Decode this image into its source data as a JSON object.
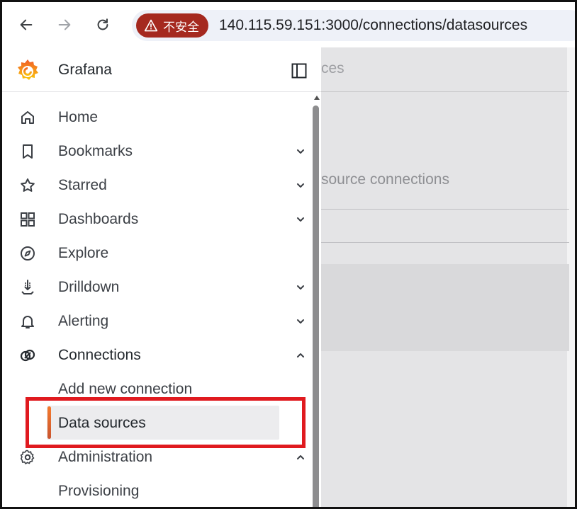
{
  "browser": {
    "security_label": "不安全",
    "url": "140.115.59.151:3000/connections/datasources"
  },
  "sidebar": {
    "brand": "Grafana",
    "items": [
      {
        "label": "Home",
        "icon": "home-icon",
        "expandable": false
      },
      {
        "label": "Bookmarks",
        "icon": "bookmark-icon",
        "expandable": true,
        "expanded": false
      },
      {
        "label": "Starred",
        "icon": "star-icon",
        "expandable": true,
        "expanded": false
      },
      {
        "label": "Dashboards",
        "icon": "apps-icon",
        "expandable": true,
        "expanded": false
      },
      {
        "label": "Explore",
        "icon": "compass-icon",
        "expandable": false
      },
      {
        "label": "Drilldown",
        "icon": "drilldown-icon",
        "expandable": true,
        "expanded": false
      },
      {
        "label": "Alerting",
        "icon": "bell-icon",
        "expandable": true,
        "expanded": false
      },
      {
        "label": "Connections",
        "icon": "connections-icon",
        "expandable": true,
        "expanded": true
      },
      {
        "label": "Administration",
        "icon": "cog-icon",
        "expandable": true,
        "expanded": true
      }
    ],
    "connections_children": [
      "Add new connection",
      "Data sources"
    ],
    "administration_children": [
      "Provisioning"
    ],
    "active_item": "Data sources",
    "accent_color": "#f57a2c"
  },
  "background_page": {
    "title_fragment": "ces",
    "subtitle_fragment": "source connections"
  },
  "highlight_color": "#e01a1f"
}
